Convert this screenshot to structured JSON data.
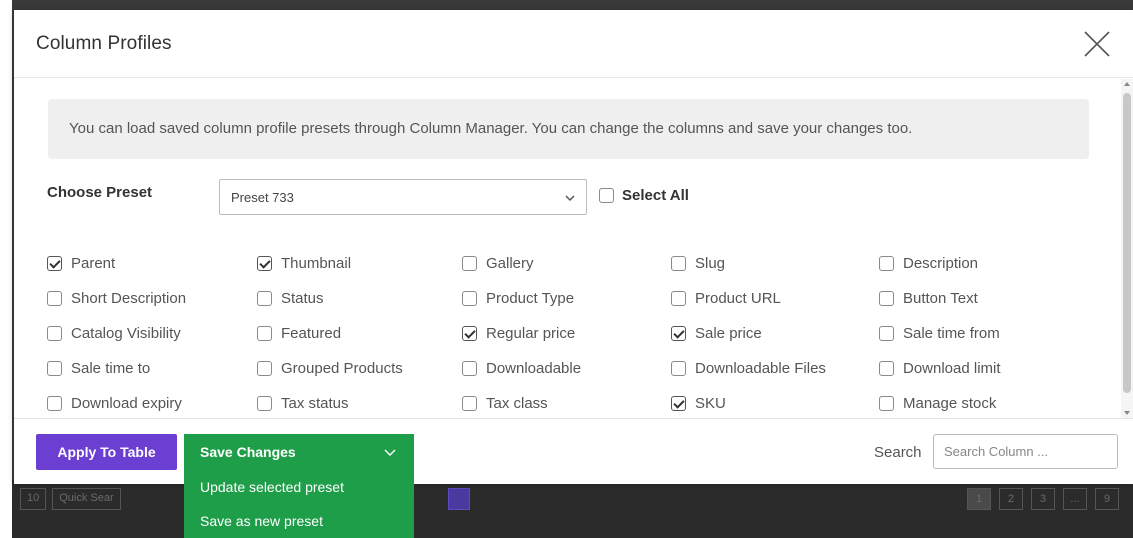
{
  "modal": {
    "title": "Column Profiles",
    "notice": "You can load saved column profile presets through Column Manager. You can change the columns and save your changes too.",
    "preset_label": "Choose Preset",
    "preset_value": "Preset 733",
    "select_all_label": "Select All"
  },
  "columns": [
    {
      "label": "Parent",
      "checked": true
    },
    {
      "label": "Thumbnail",
      "checked": true
    },
    {
      "label": "Gallery",
      "checked": false
    },
    {
      "label": "Slug",
      "checked": false
    },
    {
      "label": "Description",
      "checked": false
    },
    {
      "label": "Short Description",
      "checked": false
    },
    {
      "label": "Status",
      "checked": false
    },
    {
      "label": "Product Type",
      "checked": false
    },
    {
      "label": "Product URL",
      "checked": false
    },
    {
      "label": "Button Text",
      "checked": false
    },
    {
      "label": "Catalog Visibility",
      "checked": false
    },
    {
      "label": "Featured",
      "checked": false
    },
    {
      "label": "Regular price",
      "checked": true
    },
    {
      "label": "Sale price",
      "checked": true
    },
    {
      "label": "Sale time from",
      "checked": false
    },
    {
      "label": "Sale time to",
      "checked": false
    },
    {
      "label": "Grouped Products",
      "checked": false
    },
    {
      "label": "Downloadable",
      "checked": false
    },
    {
      "label": "Downloadable Files",
      "checked": false
    },
    {
      "label": "Download limit",
      "checked": false
    },
    {
      "label": "Download expiry",
      "checked": false
    },
    {
      "label": "Tax status",
      "checked": false
    },
    {
      "label": "Tax class",
      "checked": false
    },
    {
      "label": "SKU",
      "checked": true
    },
    {
      "label": "Manage stock",
      "checked": false
    }
  ],
  "footer": {
    "apply_label": "Apply To Table",
    "save_label": "Save Changes",
    "search_label": "Search",
    "search_placeholder": "Search Column ..."
  },
  "save_menu": {
    "items": [
      "Update selected preset",
      "Save as new preset"
    ]
  },
  "background": {
    "per_page": "10",
    "quick_search": "Quick Sear",
    "pages": [
      "1",
      "2",
      "3",
      "...",
      "9"
    ]
  },
  "colors": {
    "apply": "#6b3fd1",
    "save": "#1f9e4a"
  }
}
